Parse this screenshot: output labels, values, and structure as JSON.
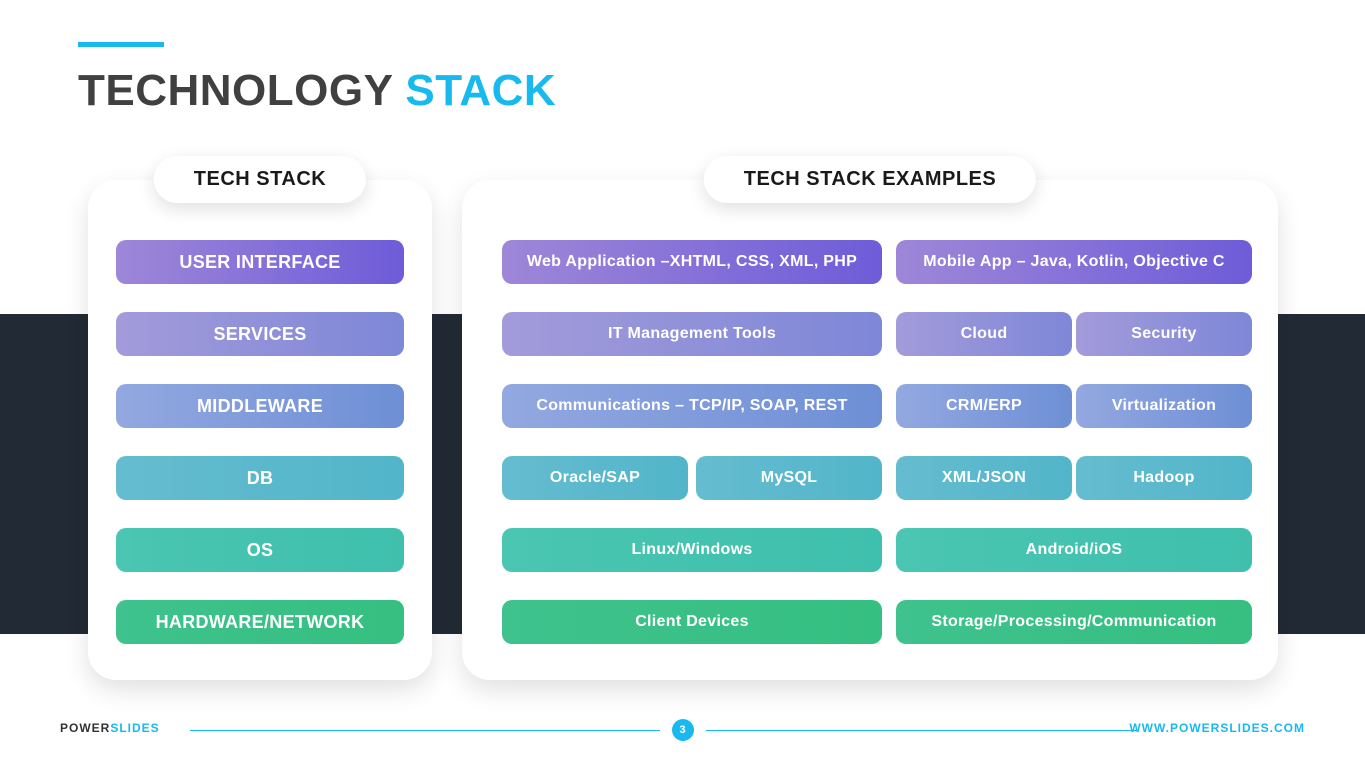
{
  "title": {
    "first": "TECHNOLOGY",
    "second": "STACK"
  },
  "left_card": {
    "title": "TECH STACK",
    "rows": [
      "USER INTERFACE",
      "SERVICES",
      "MIDDLEWARE",
      "DB",
      "OS",
      "HARDWARE/NETWORK"
    ]
  },
  "right_card": {
    "title": "TECH STACK EXAMPLES",
    "rows": [
      {
        "left_full": "Web Application –XHTML, CSS, XML, PHP",
        "right_full": "Mobile App – Java, Kotlin, Objective C"
      },
      {
        "left_full": "IT Management Tools",
        "right_a": "Cloud",
        "right_b": "Security"
      },
      {
        "left_full": "Communications – TCP/IP, SOAP, REST",
        "right_a": "CRM/ERP",
        "right_b": "Virtualization"
      },
      {
        "left_a": "Oracle/SAP",
        "left_b": "MySQL",
        "right_a": "XML/JSON",
        "right_b": "Hadoop"
      },
      {
        "left_full": "Linux/Windows",
        "right_full": "Android/iOS"
      },
      {
        "left_full": "Client Devices",
        "right_full": "Storage/Processing/Communication"
      }
    ]
  },
  "footer": {
    "brand_first": "POWER",
    "brand_second": "SLIDES",
    "page": "3",
    "url": "WWW.POWERSLIDES.COM"
  }
}
